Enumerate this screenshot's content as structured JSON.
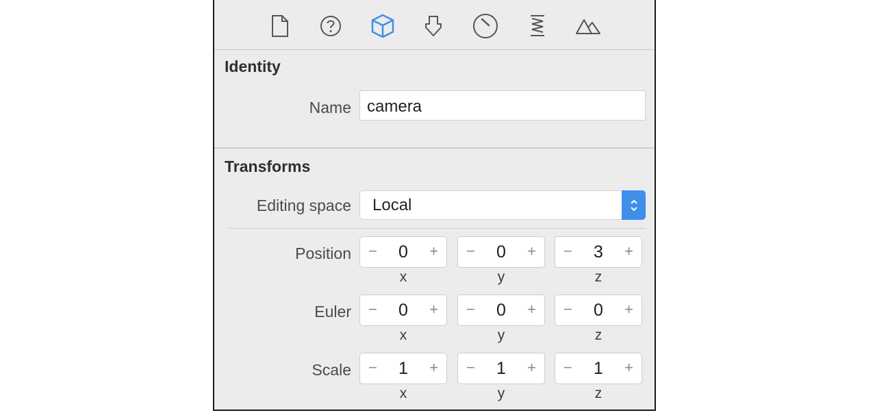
{
  "toolbar": {
    "tabs": [
      {
        "icon": "file-icon",
        "selected": false
      },
      {
        "icon": "help-icon",
        "selected": false
      },
      {
        "icon": "node-cube-icon",
        "selected": true
      },
      {
        "icon": "attributes-icon",
        "selected": false
      },
      {
        "icon": "material-icon",
        "selected": false
      },
      {
        "icon": "physics-icon",
        "selected": false
      },
      {
        "icon": "scene-icon",
        "selected": false
      }
    ],
    "accent_color": "#3f8eea"
  },
  "identity": {
    "title": "Identity",
    "name_label": "Name",
    "name_value": "camera"
  },
  "transforms": {
    "title": "Transforms",
    "editing_space_label": "Editing space",
    "editing_space_value": "Local",
    "position": {
      "label": "Position",
      "x": "0",
      "y": "0",
      "z": "3"
    },
    "euler": {
      "label": "Euler",
      "x": "0",
      "y": "0",
      "z": "0"
    },
    "scale": {
      "label": "Scale",
      "x": "1",
      "y": "1",
      "z": "1"
    },
    "axis_labels": {
      "x": "x",
      "y": "y",
      "z": "z"
    },
    "minus_symbol": "−",
    "plus_symbol": "+"
  }
}
